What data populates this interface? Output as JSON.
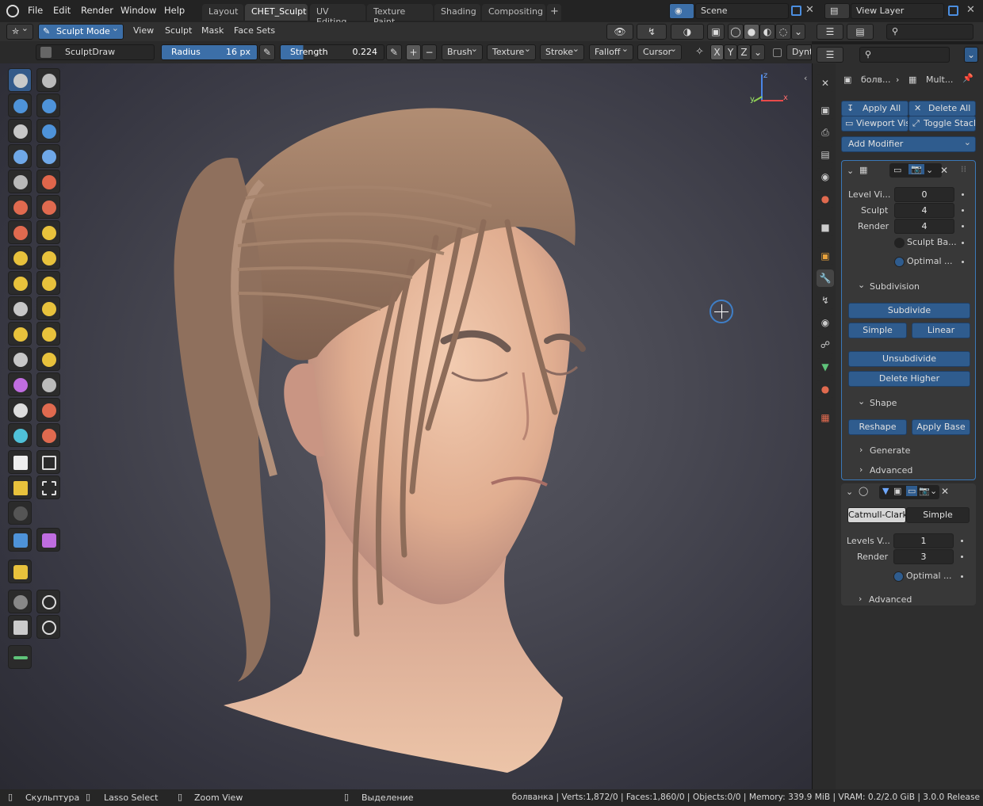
{
  "menu": [
    "File",
    "Edit",
    "Render",
    "Window",
    "Help"
  ],
  "workspaces": [
    "Layout",
    "CHET_Sculpt",
    "UV Editing",
    "Texture Paint",
    "Shading",
    "Compositing"
  ],
  "active_workspace": "CHET_Sculpt",
  "scene": {
    "label": "Scene"
  },
  "view_layer": {
    "label": "View Layer"
  },
  "header": {
    "mode": "Sculpt Mode",
    "menus": [
      "View",
      "Sculpt",
      "Mask",
      "Face Sets"
    ]
  },
  "tool_settings": {
    "brush_name": "SculptDraw",
    "radius_label": "Radius",
    "radius_value": "16 px",
    "strength_label": "Strength",
    "strength_value": "0.224",
    "plus": "+",
    "minus": "−",
    "dropdowns": [
      "Brush",
      "Texture",
      "Stroke",
      "Falloff",
      "Cursor"
    ],
    "axes": [
      "X",
      "Y",
      "Z"
    ],
    "dyntopo": "Dynt"
  },
  "gizmo": {
    "x": "x",
    "y": "y",
    "z": "z"
  },
  "properties": {
    "breadcrumb_object": "болв...",
    "breadcrumb_modifier": "Mult...",
    "apply_all": "Apply All",
    "delete_all": "Delete All",
    "viewport_vis": "Viewport Vis",
    "toggle_stack": "Toggle Stack",
    "add_modifier": "Add Modifier",
    "multires": {
      "rows": [
        {
          "label": "Level Vi...",
          "value": "0"
        },
        {
          "label": "Sculpt",
          "value": "4"
        },
        {
          "label": "Render",
          "value": "4"
        }
      ],
      "sculpt_base": "Sculpt Ba...",
      "optimal": "Optimal ...",
      "subdivision_header": "Subdivision",
      "subdivide": "Subdivide",
      "simple": "Simple",
      "linear": "Linear",
      "unsubdivide": "Unsubdivide",
      "delete_higher": "Delete Higher",
      "shape_header": "Shape",
      "reshape": "Reshape",
      "apply_base": "Apply Base",
      "generate": "Generate",
      "advanced": "Advanced"
    },
    "subsurf": {
      "catmull": "Catmull-Clark",
      "simple": "Simple",
      "rows": [
        {
          "label": "Levels V...",
          "value": "1"
        },
        {
          "label": "Render",
          "value": "3"
        }
      ],
      "optimal": "Optimal ...",
      "advanced": "Advanced"
    }
  },
  "status": {
    "sculpt": "Скульптура",
    "lasso": "Lasso Select",
    "zoom": "Zoom View",
    "select": "Выделение",
    "info": "болванка | Verts:1,872/0 | Faces:1,860/0 | Objects:0/0 | Memory: 339.9 MiB | VRAM: 0.2/2.0 GiB | 3.0.0 Release"
  },
  "colors": {
    "accent": "#3c6fa8",
    "active_tab": "#3d3d3d",
    "skin": "#e6b99a",
    "hair": "#9a7a63"
  }
}
